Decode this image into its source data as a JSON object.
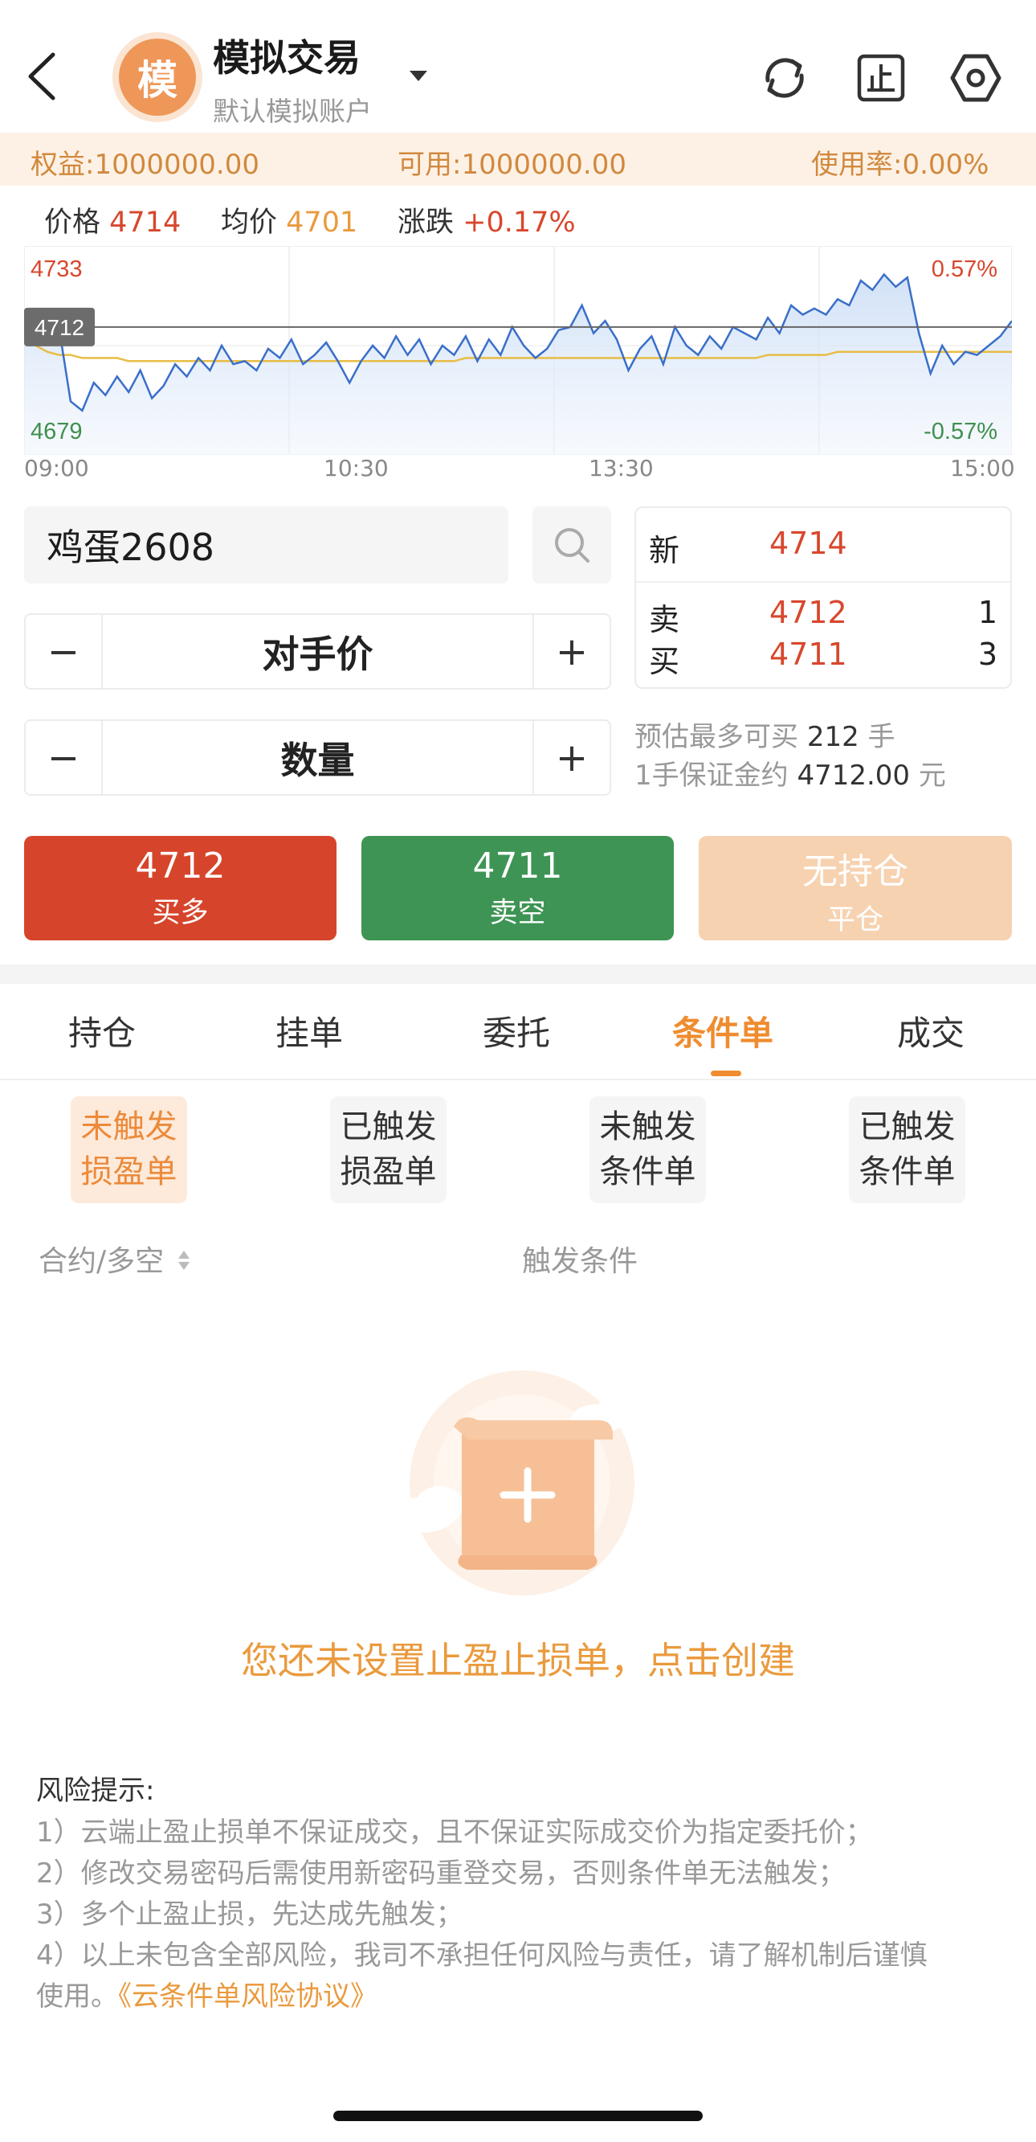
{
  "header": {
    "avatar_char": "模",
    "title": "模拟交易",
    "subtitle": "默认模拟账户"
  },
  "account": {
    "equity_label": "权益:",
    "equity_value": "1000000.00",
    "available_label": "可用:",
    "available_value": "1000000.00",
    "usage_label": "使用率:",
    "usage_value": "0.00%"
  },
  "price_row": {
    "price_label": "价格",
    "price_value": "4714",
    "avg_label": "均价",
    "avg_value": "4701",
    "change_label": "涨跌",
    "change_value": "+0.17%"
  },
  "chart_data": {
    "type": "line",
    "y_high_label": "4733",
    "y_low_label": "4679",
    "pct_high_label": "0.57%",
    "pct_low_label": "-0.57%",
    "current_label": "4712",
    "ylim": [
      4679,
      4733
    ],
    "x_ticks": [
      "09:00",
      "10:30",
      "13:30",
      "15:00"
    ],
    "series": [
      {
        "values": [
          4712,
          4708,
          4715,
          4712,
          4688,
          4685,
          4694,
          4690,
          4696,
          4691,
          4698,
          4689,
          4693,
          4700,
          4696,
          4702,
          4698,
          4706,
          4700,
          4701,
          4698,
          4705,
          4702,
          4708,
          4700,
          4703,
          4707,
          4701,
          4694,
          4701,
          4706,
          4702,
          4709,
          4703,
          4708,
          4700,
          4706,
          4703,
          4709,
          4701,
          4708,
          4703,
          4712,
          4706,
          4702,
          4705,
          4711,
          4712,
          4719,
          4710,
          4714,
          4708,
          4698,
          4705,
          4709,
          4700,
          4712,
          4706,
          4703,
          4709,
          4705,
          4712,
          4710,
          4708,
          4715,
          4710,
          4719,
          4716,
          4718,
          4716,
          4721,
          4719,
          4727,
          4724,
          4729,
          4725,
          4728,
          4710,
          4697,
          4706,
          4700,
          4704,
          4703,
          4706,
          4709,
          4714
        ],
        "color": "#3a6fc9"
      },
      {
        "values": [
          4711,
          4706,
          4704,
          4703,
          4703,
          4702,
          4702,
          4702,
          4702,
          4701,
          4701,
          4701,
          4701,
          4701,
          4701,
          4701,
          4701,
          4701,
          4701,
          4701,
          4701,
          4701,
          4701,
          4701,
          4701,
          4701,
          4701,
          4701,
          4701,
          4701,
          4701,
          4701,
          4701,
          4701,
          4701,
          4701,
          4701,
          4701,
          4702,
          4702,
          4702,
          4702,
          4702,
          4702,
          4702,
          4702,
          4702,
          4702,
          4702,
          4702,
          4702,
          4702,
          4702,
          4702,
          4702,
          4702,
          4702,
          4702,
          4702,
          4702,
          4702,
          4702,
          4702,
          4702,
          4703,
          4703,
          4703,
          4703,
          4703,
          4703,
          4704,
          4704,
          4704,
          4704,
          4704,
          4704,
          4704,
          4704,
          4704,
          4704,
          4704,
          4704,
          4704,
          4704,
          4704,
          4704
        ],
        "color": "#e8bd45"
      }
    ]
  },
  "contract": {
    "name": "鸡蛋2608"
  },
  "price_stepper": {
    "minus": "−",
    "label": "对手价",
    "plus": "+"
  },
  "qty_stepper": {
    "minus": "−",
    "label": "数量",
    "plus": "+"
  },
  "quote": {
    "last_label": "新",
    "last_price": "4714",
    "ask_label": "卖",
    "ask_price": "4712",
    "ask_qty": "1",
    "bid_label": "买",
    "bid_price": "4711",
    "bid_qty": "3"
  },
  "estimate": {
    "line1_prefix": "预估最多可买",
    "line1_num": "212",
    "line1_suffix": "手",
    "line2_prefix": "1手保证金约",
    "line2_num": "4712.00",
    "line2_suffix": "元"
  },
  "actions": {
    "buy_price": "4712",
    "buy_label": "买多",
    "sell_price": "4711",
    "sell_label": "卖空",
    "close_top": "无持仓",
    "close_label": "平仓"
  },
  "tabs": [
    "持仓",
    "挂单",
    "委托",
    "条件单",
    "成交"
  ],
  "subtabs": [
    {
      "line1": "未触发",
      "line2": "损盈单"
    },
    {
      "line1": "已触发",
      "line2": "损盈单"
    },
    {
      "line1": "未触发",
      "line2": "条件单"
    },
    {
      "line1": "已触发",
      "line2": "条件单"
    }
  ],
  "list_header": {
    "col1": "合约/多空",
    "col2": "触发条件"
  },
  "empty_text": "您还未设置止盈止损单，点击创建",
  "risk": {
    "title": "风险提示:",
    "line1": "1）云端止盈止损单不保证成交，且不保证实际成交价为指定委托价；",
    "line2": "2）修改交易密码后需使用新密码重登交易，否则条件单无法触发；",
    "line3": "3）多个止盈止损，先达成先触发；",
    "line4": "4）以上未包含全部风险，我司不承担任何风险与责任，请了解机制后谨慎",
    "line5_prefix": "使用。",
    "line5_link": "《云条件单风险协议》"
  },
  "colors": {
    "accent": "#ef8c2f",
    "buy": "#d6452b",
    "sell": "#3e9454",
    "close": "#f7d2b0"
  }
}
